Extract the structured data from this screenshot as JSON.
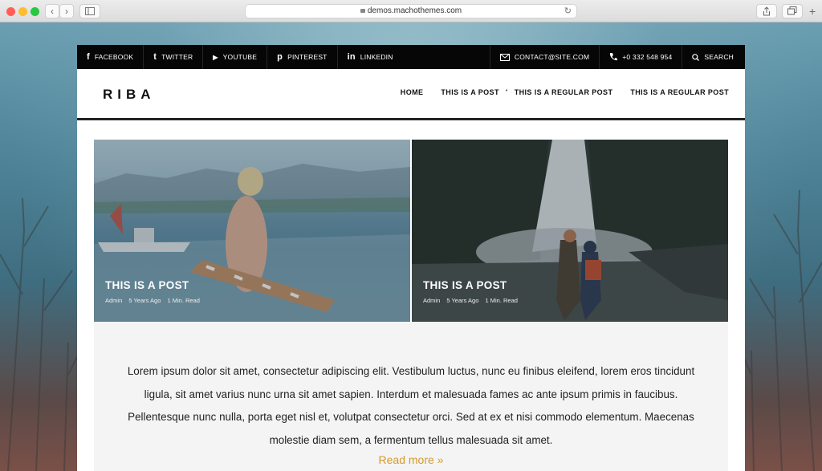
{
  "browser": {
    "url": "demos.machothemes.com",
    "back_glyph": "‹",
    "forward_glyph": "›",
    "reload_glyph": "↻",
    "plus_glyph": "+"
  },
  "topbar": {
    "social": [
      {
        "icon": "facebook-icon",
        "glyph": "f",
        "label": "FACEBOOK"
      },
      {
        "icon": "twitter-icon",
        "glyph": "t",
        "label": "TWITTER"
      },
      {
        "icon": "youtube-icon",
        "glyph": "▶",
        "label": "YOUTUBE"
      },
      {
        "icon": "pinterest-icon",
        "glyph": "p",
        "label": "PINTEREST"
      },
      {
        "icon": "linkedin-icon",
        "glyph": "in",
        "label": "LINKEDIN"
      }
    ],
    "email": "CONTACT@SITE.COM",
    "phone": "+0 332 548 954",
    "search": "SEARCH"
  },
  "header": {
    "logo": "RIBA",
    "nav": [
      "HOME",
      "THIS IS A POST",
      "THIS IS A REGULAR POST",
      "THIS IS A REGULAR POST"
    ]
  },
  "posts": [
    {
      "title": "THIS IS A POST",
      "author": "Admin",
      "age": "5 Years Ago",
      "read": "1 Min. Read"
    },
    {
      "title": "THIS IS A POST",
      "author": "Admin",
      "age": "5 Years Ago",
      "read": "1 Min. Read"
    }
  ],
  "excerpt": {
    "text": "Lorem ipsum dolor sit amet, consectetur adipiscing elit. Vestibulum luctus, nunc eu finibus eleifend, lorem eros tincidunt ligula, sit amet varius nunc urna sit amet sapien. Interdum et malesuada fames ac ante ipsum primis in faucibus. Pellentesque nunc nulla, porta eget nisl et, volutpat consectetur orci. Sed at ex et nisi commodo elementum. Maecenas molestie diam sem, a fermentum tellus malesuada sit amet.",
    "read_more": "Read more »"
  },
  "colors": {
    "accent": "#d39a2e",
    "topbar": "#060606"
  }
}
